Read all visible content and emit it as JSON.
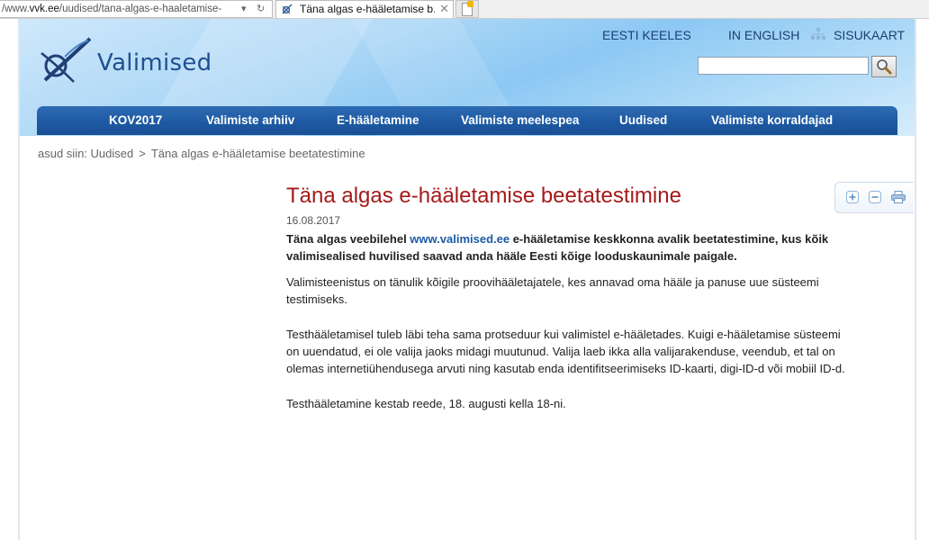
{
  "browser": {
    "address_pre": "/www.",
    "address_domain": "vvk.ee",
    "address_post": "/uudised/tana-algas-e-haaletamise-",
    "tab_title": "Täna algas e-hääletamise b...",
    "tab_close": "✕"
  },
  "header": {
    "logo_text": "Valimised",
    "lang_et": "EESTI KEELES",
    "lang_en": "IN ENGLISH",
    "sitemap": "SISUKAART",
    "search_value": ""
  },
  "nav": {
    "items": [
      "KOV2017",
      "Valimiste arhiiv",
      "E-hääletamine",
      "Valimiste meelespea",
      "Uudised",
      "Valimiste korraldajad"
    ]
  },
  "breadcrumb": {
    "prefix": "asud siin:",
    "items": [
      "Uudised",
      "Täna algas e-hääletamise beetatestimine"
    ],
    "separator": ">"
  },
  "article": {
    "title": "Täna algas e-hääletamise beetatestimine",
    "date": "16.08.2017",
    "lead_before": "Täna algas veebilehel ",
    "lead_link": "www.valimised.ee",
    "lead_after": " e-hääletamise keskkonna avalik beetatestimine, kus kõik valimisealised huvilised saavad anda hääle Eesti kõige looduskaunimale paigale.",
    "paragraphs": [
      "Valimisteenistus on tänulik kõigile proovihääletajatele, kes annavad oma hääle ja panuse uue süsteemi testimiseks.",
      "Testhääletamisel tuleb läbi teha sama protseduur kui valimistel e-hääletades. Kuigi e-hääletamise süsteemi on uuendatud, ei ole valija jaoks midagi muutunud. Valija laeb ikka alla valijarakenduse, veendub, et tal on olemas internetiühendusega arvuti ning kasutab enda identifitseerimiseks ID-kaarti, digi-ID-d või mobiil ID-d.",
      "Testhääletamine kestab reede, 18. augusti kella 18-ni."
    ]
  },
  "colors": {
    "nav_bg": "#1d5aa3",
    "title_red": "#a41a1a",
    "link_blue": "#1c5aa6",
    "logo_blue": "#1f4f91"
  },
  "icons": [
    "refresh-icon",
    "dropdown-arrow-icon",
    "favicon-icon",
    "close-icon",
    "new-tab-icon",
    "logo-mark-icon",
    "sitemap-icon",
    "magnifier-icon",
    "zoom-in-icon",
    "zoom-out-icon",
    "print-icon"
  ]
}
